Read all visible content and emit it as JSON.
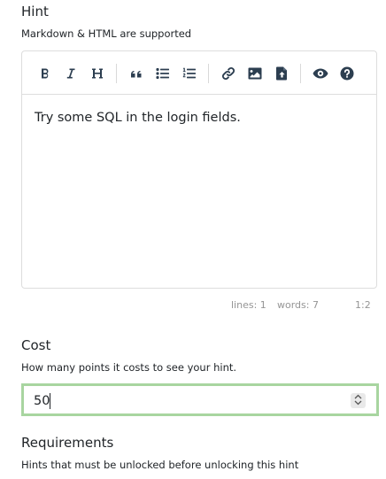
{
  "hint": {
    "label": "Hint",
    "help": "Markdown & HTML are supported",
    "toolbar": {
      "bold_icon": "bold-icon",
      "italic_icon": "italic-icon",
      "heading_icon": "heading-icon",
      "quote_icon": "quote-icon",
      "unordered_list_icon": "unordered-list-icon",
      "ordered_list_icon": "ordered-list-icon",
      "link_icon": "link-icon",
      "image_icon": "image-icon",
      "upload_icon": "file-upload-icon",
      "preview_icon": "eye-icon",
      "help_icon": "question-circle-icon"
    },
    "content": "Try some SQL in the login fields.",
    "status": {
      "lines": "lines: 1",
      "words": "words: 7",
      "cursor": "1:2"
    }
  },
  "cost": {
    "label": "Cost",
    "help": "How many points it costs to see your hint.",
    "value": "50"
  },
  "requirements": {
    "label": "Requirements",
    "help": "Hints that must be unlocked before unlocking this hint"
  },
  "colors": {
    "focus_border": "#a8d5a0",
    "editor_border": "#dddddd",
    "status_text": "#959595",
    "icon": "#2c3e50"
  }
}
